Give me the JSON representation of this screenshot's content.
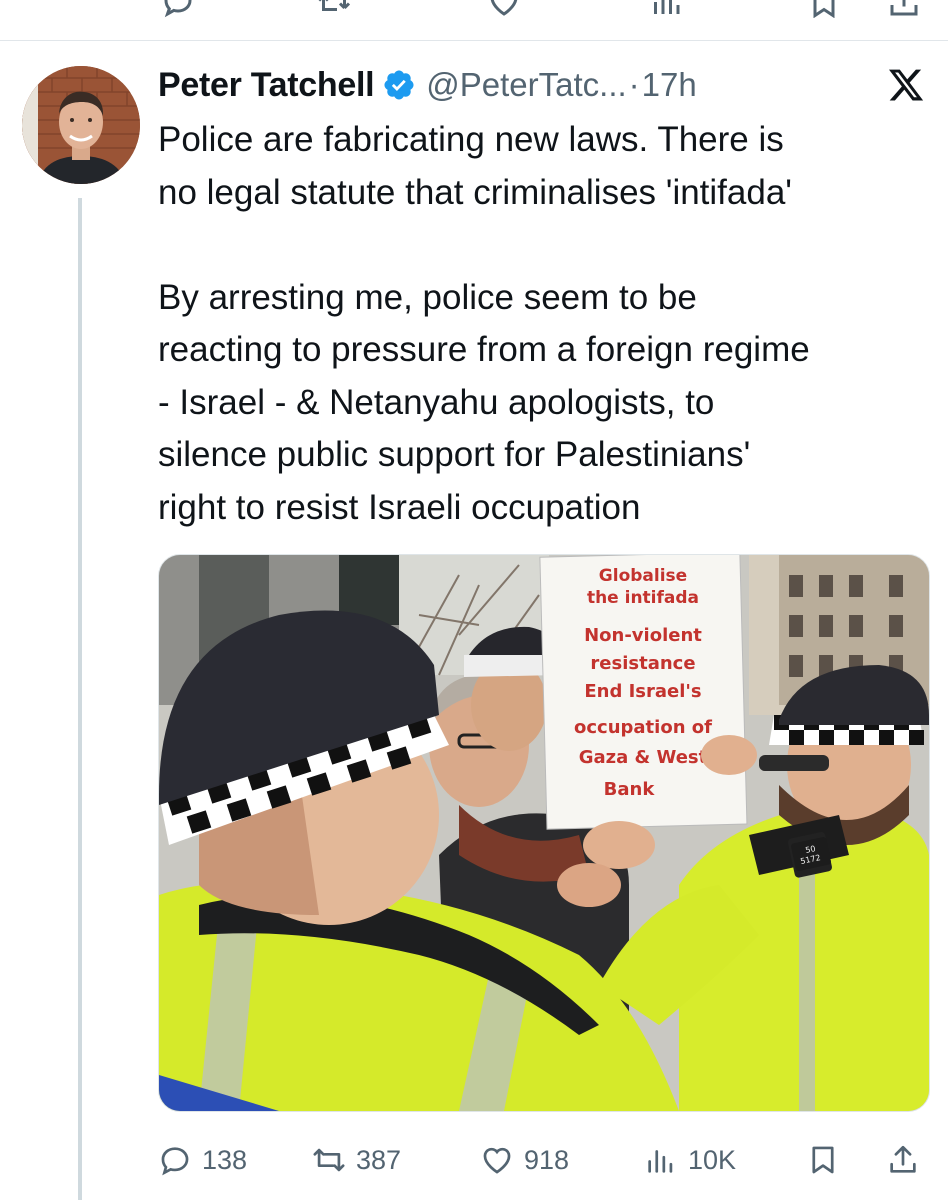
{
  "tweet": {
    "author_name": "Peter Tatchell",
    "handle": "@PeterTatc...",
    "separator": "·",
    "time": "17h",
    "verified": true,
    "text": "Police are fabricating new laws. There is\nno legal statute that criminalises 'intifada'\n\nBy arresting me, police seem to be\nreacting to pressure from a foreign regime\n- Israel - & Netanyahu apologists, to\nsilence public support for Palestinians'\nright to resist Israeli occupation",
    "media": {
      "placard_lines": [
        "Globalise",
        "the intifada",
        "Non-violent",
        "resistance",
        "End Israel's",
        "occupation of",
        "Gaza & West",
        "Bank"
      ],
      "badge_lines": [
        "50",
        "5172"
      ]
    },
    "actions": {
      "replies": "138",
      "reposts": "387",
      "likes": "918",
      "views": "10K"
    }
  },
  "icons": {
    "verified": "verified-badge-icon",
    "brand": "x-logo-icon",
    "reply": "reply-icon",
    "repost": "repost-icon",
    "like": "heart-icon",
    "views": "views-icon",
    "bookmark": "bookmark-icon",
    "share": "share-icon"
  },
  "colors": {
    "text": "#0f1419",
    "secondary": "#536471",
    "verified": "#1d9bf0",
    "placard_text": "#c3332e"
  }
}
